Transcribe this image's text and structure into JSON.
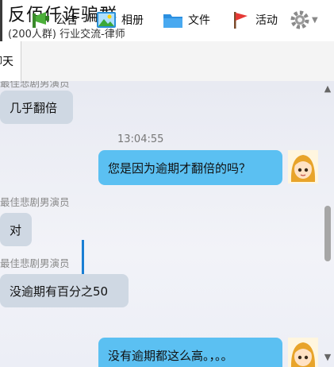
{
  "header": {
    "title": "反佰仟诈骗群",
    "subtitle": "(200人群) 行业交流-律师"
  },
  "toolbar": {
    "chat_tab": "聊天",
    "items": [
      {
        "label": "公告",
        "icon": "megaphone-icon"
      },
      {
        "label": "相册",
        "icon": "photo-album-icon"
      },
      {
        "label": "文件",
        "icon": "folder-icon"
      },
      {
        "label": "活动",
        "icon": "flag-icon"
      }
    ],
    "settings_icon": "gear-icon"
  },
  "messages": [
    {
      "side": "in",
      "sender": "最佳悲剧男演员",
      "text": "几乎翻倍"
    },
    {
      "time": "13:04:55"
    },
    {
      "side": "out",
      "text": "您是因为逾期才翻倍的吗？"
    },
    {
      "side": "in",
      "sender": "最佳悲剧男演员",
      "text": "对"
    },
    {
      "side": "in",
      "sender": "最佳悲剧男演员",
      "text": "没逾期有百分之50"
    },
    {
      "side": "out",
      "text": "没有逾期都这么高。，。。"
    }
  ],
  "colors": {
    "incoming_bubble": "#cfd8e3",
    "outgoing_bubble": "#5bc0f2",
    "accent": "#1a7fd4"
  }
}
